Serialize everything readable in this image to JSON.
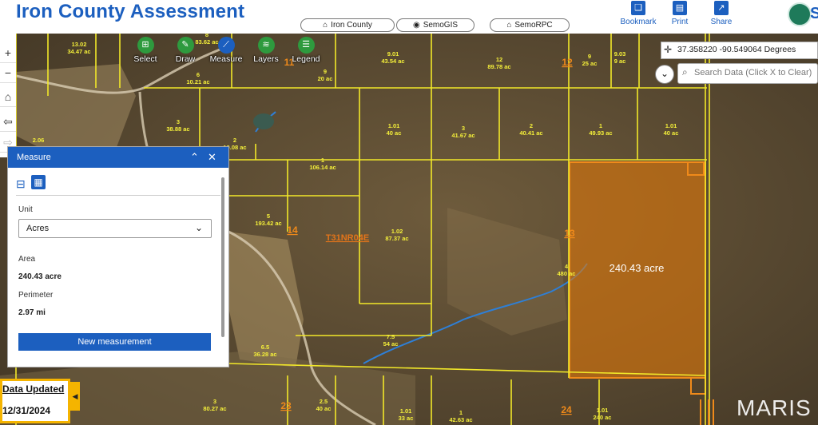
{
  "header": {
    "title": "Iron County Assessment",
    "nav_pills": [
      {
        "label": "Iron County",
        "icon": "home-icon"
      },
      {
        "label": "SemoGIS",
        "icon": "map-pin-icon"
      },
      {
        "label": "SemoRPC",
        "icon": "home-icon"
      }
    ],
    "actions": [
      {
        "label": "Bookmark",
        "icon": "bookmark-icon"
      },
      {
        "label": "Print",
        "icon": "printer-icon"
      },
      {
        "label": "Share",
        "icon": "share-icon"
      }
    ],
    "logo_text": "S"
  },
  "toolbar": [
    {
      "label": "Select",
      "icon": "select-icon",
      "color": "#2e9a3e"
    },
    {
      "label": "Draw",
      "icon": "draw-icon",
      "color": "#2e9a3e"
    },
    {
      "label": "Measure",
      "icon": "ruler-icon",
      "color": "#1c5fbf"
    },
    {
      "label": "Layers",
      "icon": "layers-icon",
      "color": "#2e9a3e"
    },
    {
      "label": "Legend",
      "icon": "list-icon",
      "color": "#2e9a3e"
    }
  ],
  "left_tools": [
    "+",
    "−",
    "⌂",
    "⇦",
    "⇨",
    "▭"
  ],
  "coordinates": "37.358220 -90.549064 Degrees",
  "search": {
    "placeholder": "Search Data (Click X to Clear)"
  },
  "measure_panel": {
    "title": "Measure",
    "unit_label": "Unit",
    "unit_value": "Acres",
    "area_label": "Area",
    "area_value": "240.43 acre",
    "perimeter_label": "Perimeter",
    "perimeter_value": "2.97 mi",
    "button": "New measurement"
  },
  "data_updated": {
    "label": "Data Updated",
    "date": "12/31/2024"
  },
  "watermark": "MARIS",
  "map": {
    "measured_area_label": "240.43 acre",
    "township_label": "T31NR04E",
    "section_labels": [
      "12",
      "14",
      "13",
      "23",
      "24",
      "11"
    ],
    "parcels": [
      {
        "id": "13.02",
        "acres": "34.47 ac"
      },
      {
        "id": "9.01",
        "acres": "43.54 ac"
      },
      {
        "id": "12",
        "acres": "89.78 ac"
      },
      {
        "id": "9",
        "acres": "25 ac"
      },
      {
        "id": "9.03",
        "acres": "9 ac"
      },
      {
        "id": "8",
        "acres": "83.62 ac"
      },
      {
        "id": "6",
        "acres": "10.21 ac"
      },
      {
        "id": "9",
        "acres": "20 ac"
      },
      {
        "id": "3",
        "acres": "38.88 ac"
      },
      {
        "id": "1.01",
        "acres": "40 ac"
      },
      {
        "id": "3",
        "acres": "41.67 ac"
      },
      {
        "id": "2",
        "acres": "40.41 ac"
      },
      {
        "id": "1",
        "acres": "49.93 ac"
      },
      {
        "id": "1.01",
        "acres": "40 ac"
      },
      {
        "id": "2",
        "acres": "10.08 ac"
      },
      {
        "id": "1",
        "acres": "106.14 ac"
      },
      {
        "id": "5",
        "acres": "193.42 ac"
      },
      {
        "id": "1.02",
        "acres": "87.37 ac"
      },
      {
        "id": "4",
        "acres": "480 ac"
      },
      {
        "id": "7.5",
        "acres": "54 ac"
      },
      {
        "id": "6.5",
        "acres": "36.28 ac"
      },
      {
        "id": "3",
        "acres": "80.27 ac"
      },
      {
        "id": "2.5",
        "acres": "40 ac"
      },
      {
        "id": "1.01",
        "acres": "33 ac"
      },
      {
        "id": "1",
        "acres": "42.63 ac"
      },
      {
        "id": "1.01",
        "acres": "240 ac"
      }
    ],
    "misc_labels": [
      "2.06"
    ]
  }
}
